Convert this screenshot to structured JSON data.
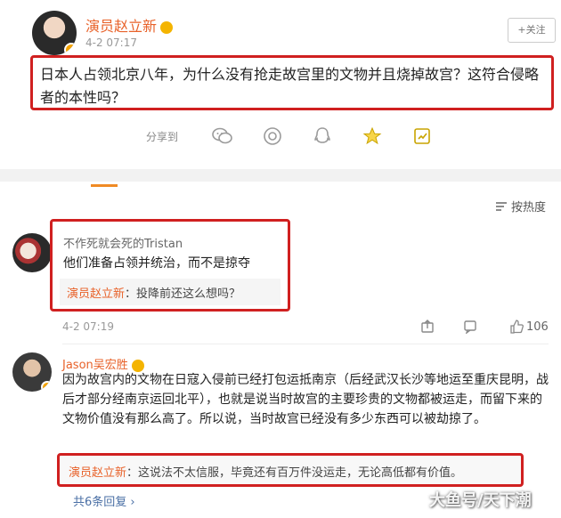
{
  "post": {
    "author": "演员赵立新",
    "time": "4-2 07:17",
    "follow_label": "+关注",
    "text": "日本人占领北京八年，为什么没有抢走故宫里的文物并且烧掉故宫？这符合侵略者的本性吗？",
    "share_label": "分享到",
    "share_icons": [
      "wechat-icon",
      "moments-icon",
      "qq-icon",
      "qzone-icon",
      "weibo-share-icon"
    ]
  },
  "comments_header": {
    "sort_label": "按热度"
  },
  "comments": [
    {
      "author": "不作死就会死的Tristan",
      "text": "他们准备占领并统治，而不是掠夺",
      "reply_author": "演员赵立新",
      "reply_text": "：投降前还这么想吗？",
      "time": "4-2 07:19",
      "likes": "106"
    },
    {
      "author": "Jason吴宏胜",
      "text": "因为故宫内的文物在日寇入侵前已经打包运抵南京（后经武汉长沙等地运至重庆昆明，战后才部分经南京运回北平），也就是说当时故宫的主要珍贵的文物都被运走，而留下来的文物价值没有那么高了。所以说，当时故宫已经没有多少东西可以被劫掠了。",
      "reply_author": "演员赵立新",
      "reply_text": "：这说法不太信服，毕竟还有百万件没运走，无论高低都有价值。",
      "more_replies": "共6条回复 ›"
    }
  ],
  "watermark": "大鱼号/天下潮",
  "colors": {
    "highlight_border": "#d02020",
    "author_orange": "#e8622a",
    "link_blue": "#4a6fa5"
  }
}
